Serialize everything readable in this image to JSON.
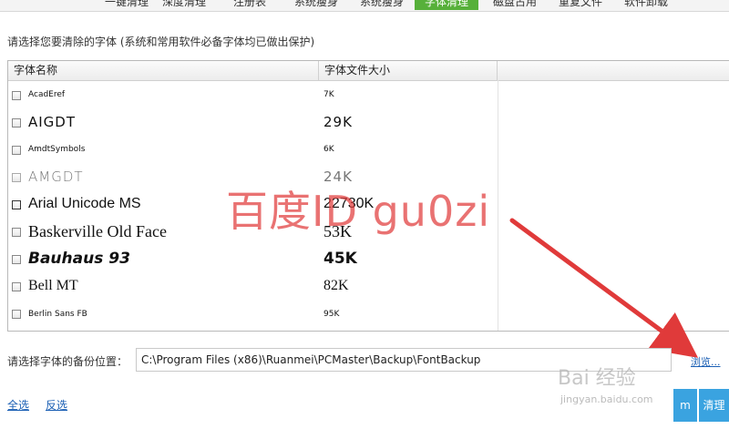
{
  "tabs": [
    {
      "label": "一键清理"
    },
    {
      "label": "深度清理"
    },
    {
      "label": "注册表"
    },
    {
      "label": "系统瘦身"
    },
    {
      "label": "系统瘦身"
    },
    {
      "label": "字体清理"
    },
    {
      "label": "磁盘占用"
    },
    {
      "label": "重复文件"
    },
    {
      "label": "软件卸载"
    }
  ],
  "instruction": "请选择您要清除的字体 (系统和常用软件必备字体均已做出保护)",
  "table": {
    "columns": [
      "字体名称",
      "字体文件大小"
    ],
    "rows": [
      {
        "name": "AcadEref",
        "size": "7K"
      },
      {
        "name": "AIGDT",
        "size": "29K"
      },
      {
        "name": "AmdtSymbols",
        "size": "6K"
      },
      {
        "name": "AMGDT",
        "size": "24K"
      },
      {
        "name": "Arial Unicode MS",
        "size": "22730K"
      },
      {
        "name": "Baskerville Old Face",
        "size": "53K"
      },
      {
        "name": "Bauhaus 93",
        "size": "45K"
      },
      {
        "name": "Bell MT",
        "size": "82K"
      },
      {
        "name": "Berlin Sans FB",
        "size": "95K"
      }
    ]
  },
  "watermark": "百度ID gu0zi",
  "backup": {
    "label": "请选择字体的备份位置：",
    "path": "C:\\Program Files (x86)\\Ruanmei\\PCMaster\\Backup\\FontBackup",
    "browse": "浏览..."
  },
  "select_all": "全选",
  "invert": "反选",
  "btn_partial": "m",
  "btn_clean": "清理",
  "baidu_logo": "Bai 经验",
  "baidu_url": "jingyan.baidu.com",
  "colors": {
    "active_tab": "#57b03a",
    "button": "#3aa3e0",
    "watermark": "#e13c3c",
    "link": "#1a5fb4"
  }
}
